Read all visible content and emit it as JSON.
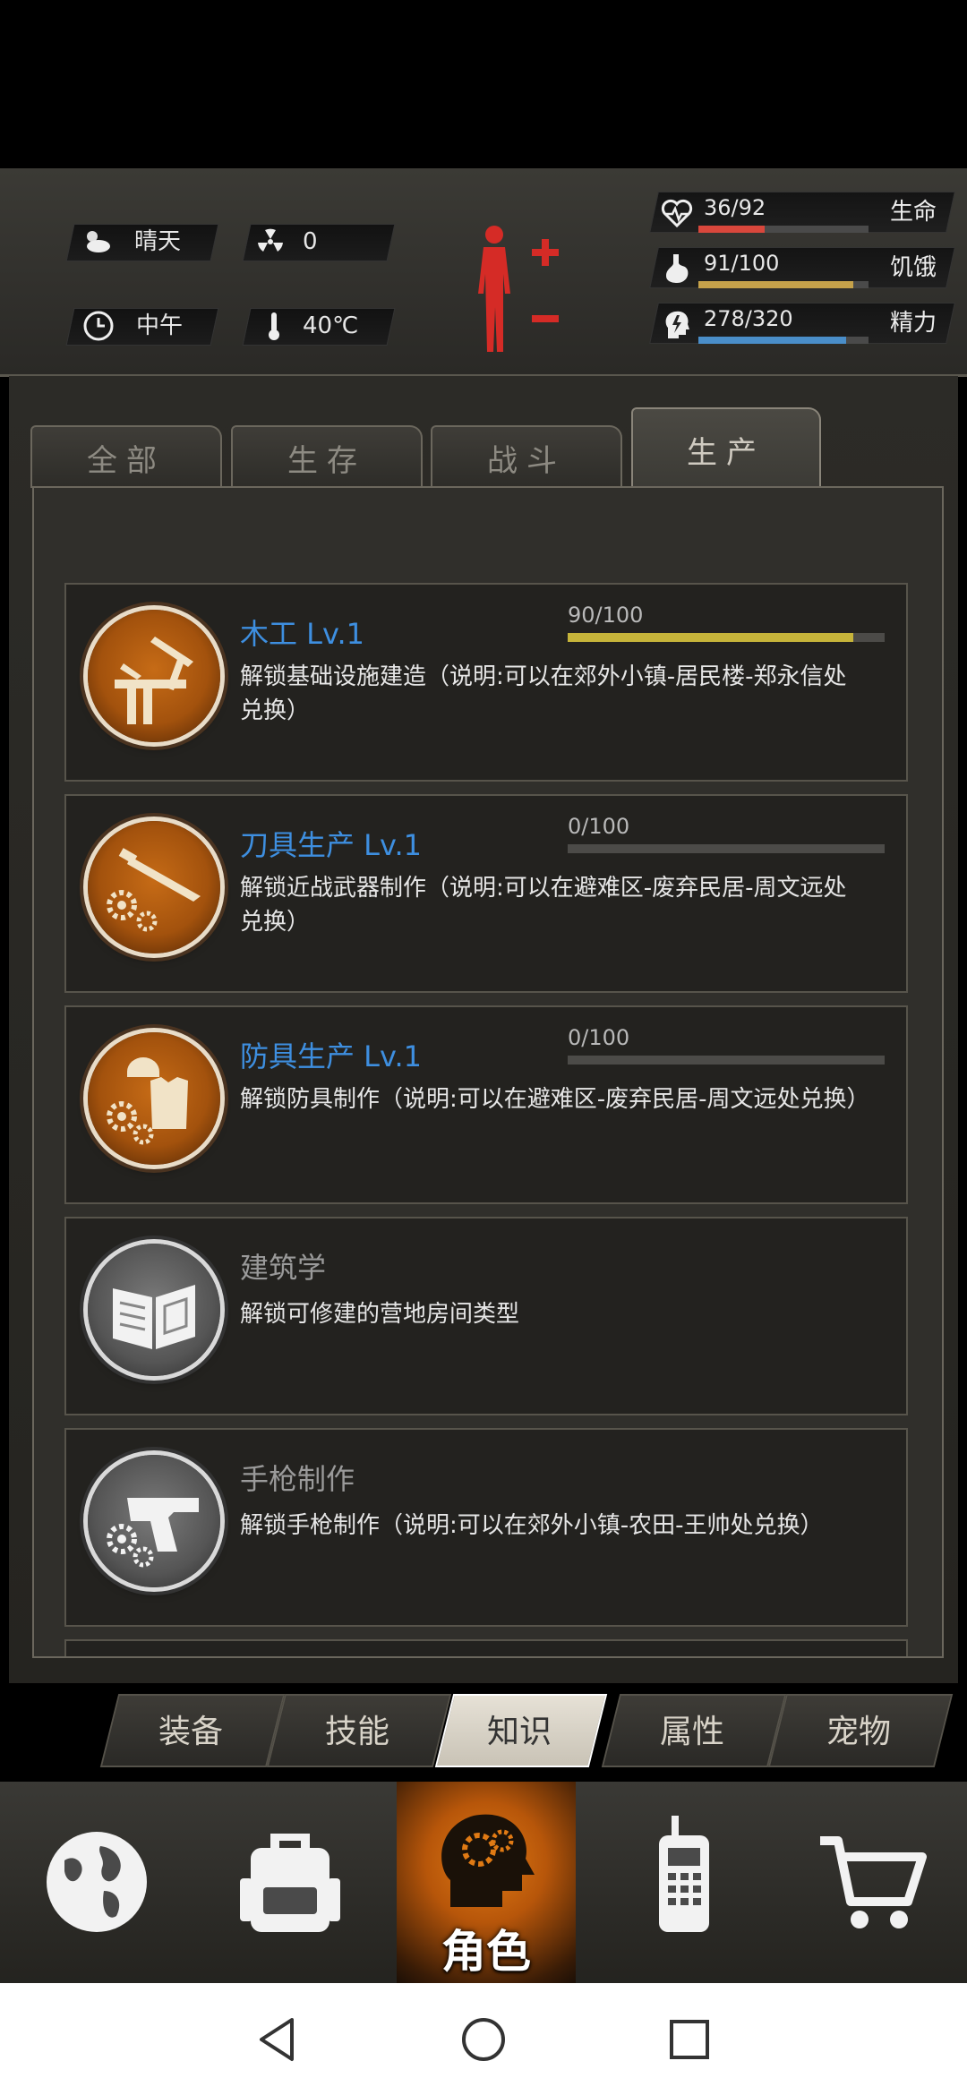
{
  "status": {
    "weather": "晴天",
    "radiation": "0",
    "time_of_day": "中午",
    "temperature": "40℃"
  },
  "meters": [
    {
      "value": "36/92",
      "label": "生命",
      "fill": 0.39,
      "color": "#d9473c"
    },
    {
      "value": "91/100",
      "label": "饥饿",
      "fill": 0.91,
      "color": "#c6a24a"
    },
    {
      "value": "278/320",
      "label": "精力",
      "fill": 0.87,
      "color": "#4a8ec9"
    }
  ],
  "tabs": [
    "全部",
    "生存",
    "战斗",
    "生产"
  ],
  "active_tab": 3,
  "cards": [
    {
      "title": "木工 Lv.1",
      "desc": "解锁基础设施建造（说明:可以在郊外小镇-居民楼-郑永信处兑换）",
      "progress_text": "90/100",
      "progress": 0.9,
      "locked": false,
      "icon": "carpentry-icon"
    },
    {
      "title": "刀具生产 Lv.1",
      "desc": "解锁近战武器制作（说明:可以在避难区-废弃民居-周文远处兑换）",
      "progress_text": "0/100",
      "progress": 0.0,
      "locked": false,
      "icon": "knife-production-icon"
    },
    {
      "title": "防具生产 Lv.1",
      "desc": "解锁防具制作（说明:可以在避难区-废弃民居-周文远处兑换）",
      "progress_text": "0/100",
      "progress": 0.0,
      "locked": false,
      "icon": "armor-production-icon"
    },
    {
      "title": "建筑学",
      "desc": "解锁可修建的营地房间类型",
      "locked": true,
      "icon": "architecture-book-icon"
    },
    {
      "title": "手枪制作",
      "desc": "解锁手枪制作（说明:可以在郊外小镇-农田-王帅处兑换）",
      "locked": true,
      "icon": "pistol-production-icon"
    }
  ],
  "sub_tabs": [
    "装备",
    "技能",
    "知识",
    "属性",
    "宠物"
  ],
  "active_sub_tab": 2,
  "bottom_nav": {
    "role_label": "角色",
    "items": [
      "globe-icon",
      "backpack-icon",
      "role-head-icon",
      "radio-icon",
      "cart-icon"
    ]
  }
}
